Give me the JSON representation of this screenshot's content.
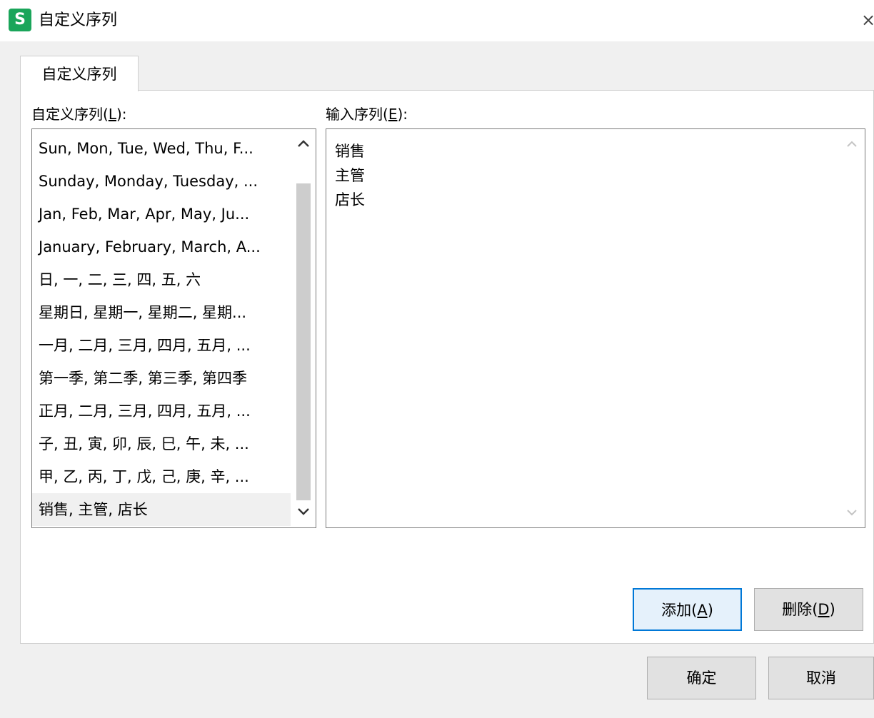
{
  "window": {
    "title": "自定义序列",
    "app_icon_letter": "S",
    "close_glyph": "×"
  },
  "tabs": [
    {
      "label": "自定义序列"
    }
  ],
  "custom_list": {
    "label_prefix": "自定义序列(",
    "label_key": "L",
    "label_suffix": "):",
    "items": [
      "Sun, Mon, Tue, Wed, Thu, F...",
      "Sunday, Monday, Tuesday, ...",
      "Jan, Feb, Mar, Apr, May, Ju...",
      "January, February, March, A...",
      "日, 一, 二, 三, 四, 五, 六",
      "星期日, 星期一, 星期二, 星期...",
      "一月, 二月, 三月, 四月, 五月, ...",
      "第一季, 第二季, 第三季, 第四季",
      "正月, 二月, 三月, 四月, 五月, ...",
      "子, 丑, 寅, 卯, 辰, 巳, 午, 未, ...",
      "甲, 乙, 丙, 丁, 戊, 己, 庚, 辛, ...",
      "销售, 主管, 店长"
    ],
    "selected_index": 11
  },
  "input_series": {
    "label_prefix": "输入序列(",
    "label_key": "E",
    "label_suffix": "):",
    "value": "销售\n主管\n店长"
  },
  "buttons": {
    "add": {
      "prefix": "添加(",
      "key": "A",
      "suffix": ")"
    },
    "delete": {
      "prefix": "删除(",
      "key": "D",
      "suffix": ")"
    },
    "ok": "确定",
    "cancel": "取消"
  },
  "icons": {
    "scroll_up": "chevron-up-icon",
    "scroll_down": "chevron-down-icon",
    "close": "close-icon"
  }
}
